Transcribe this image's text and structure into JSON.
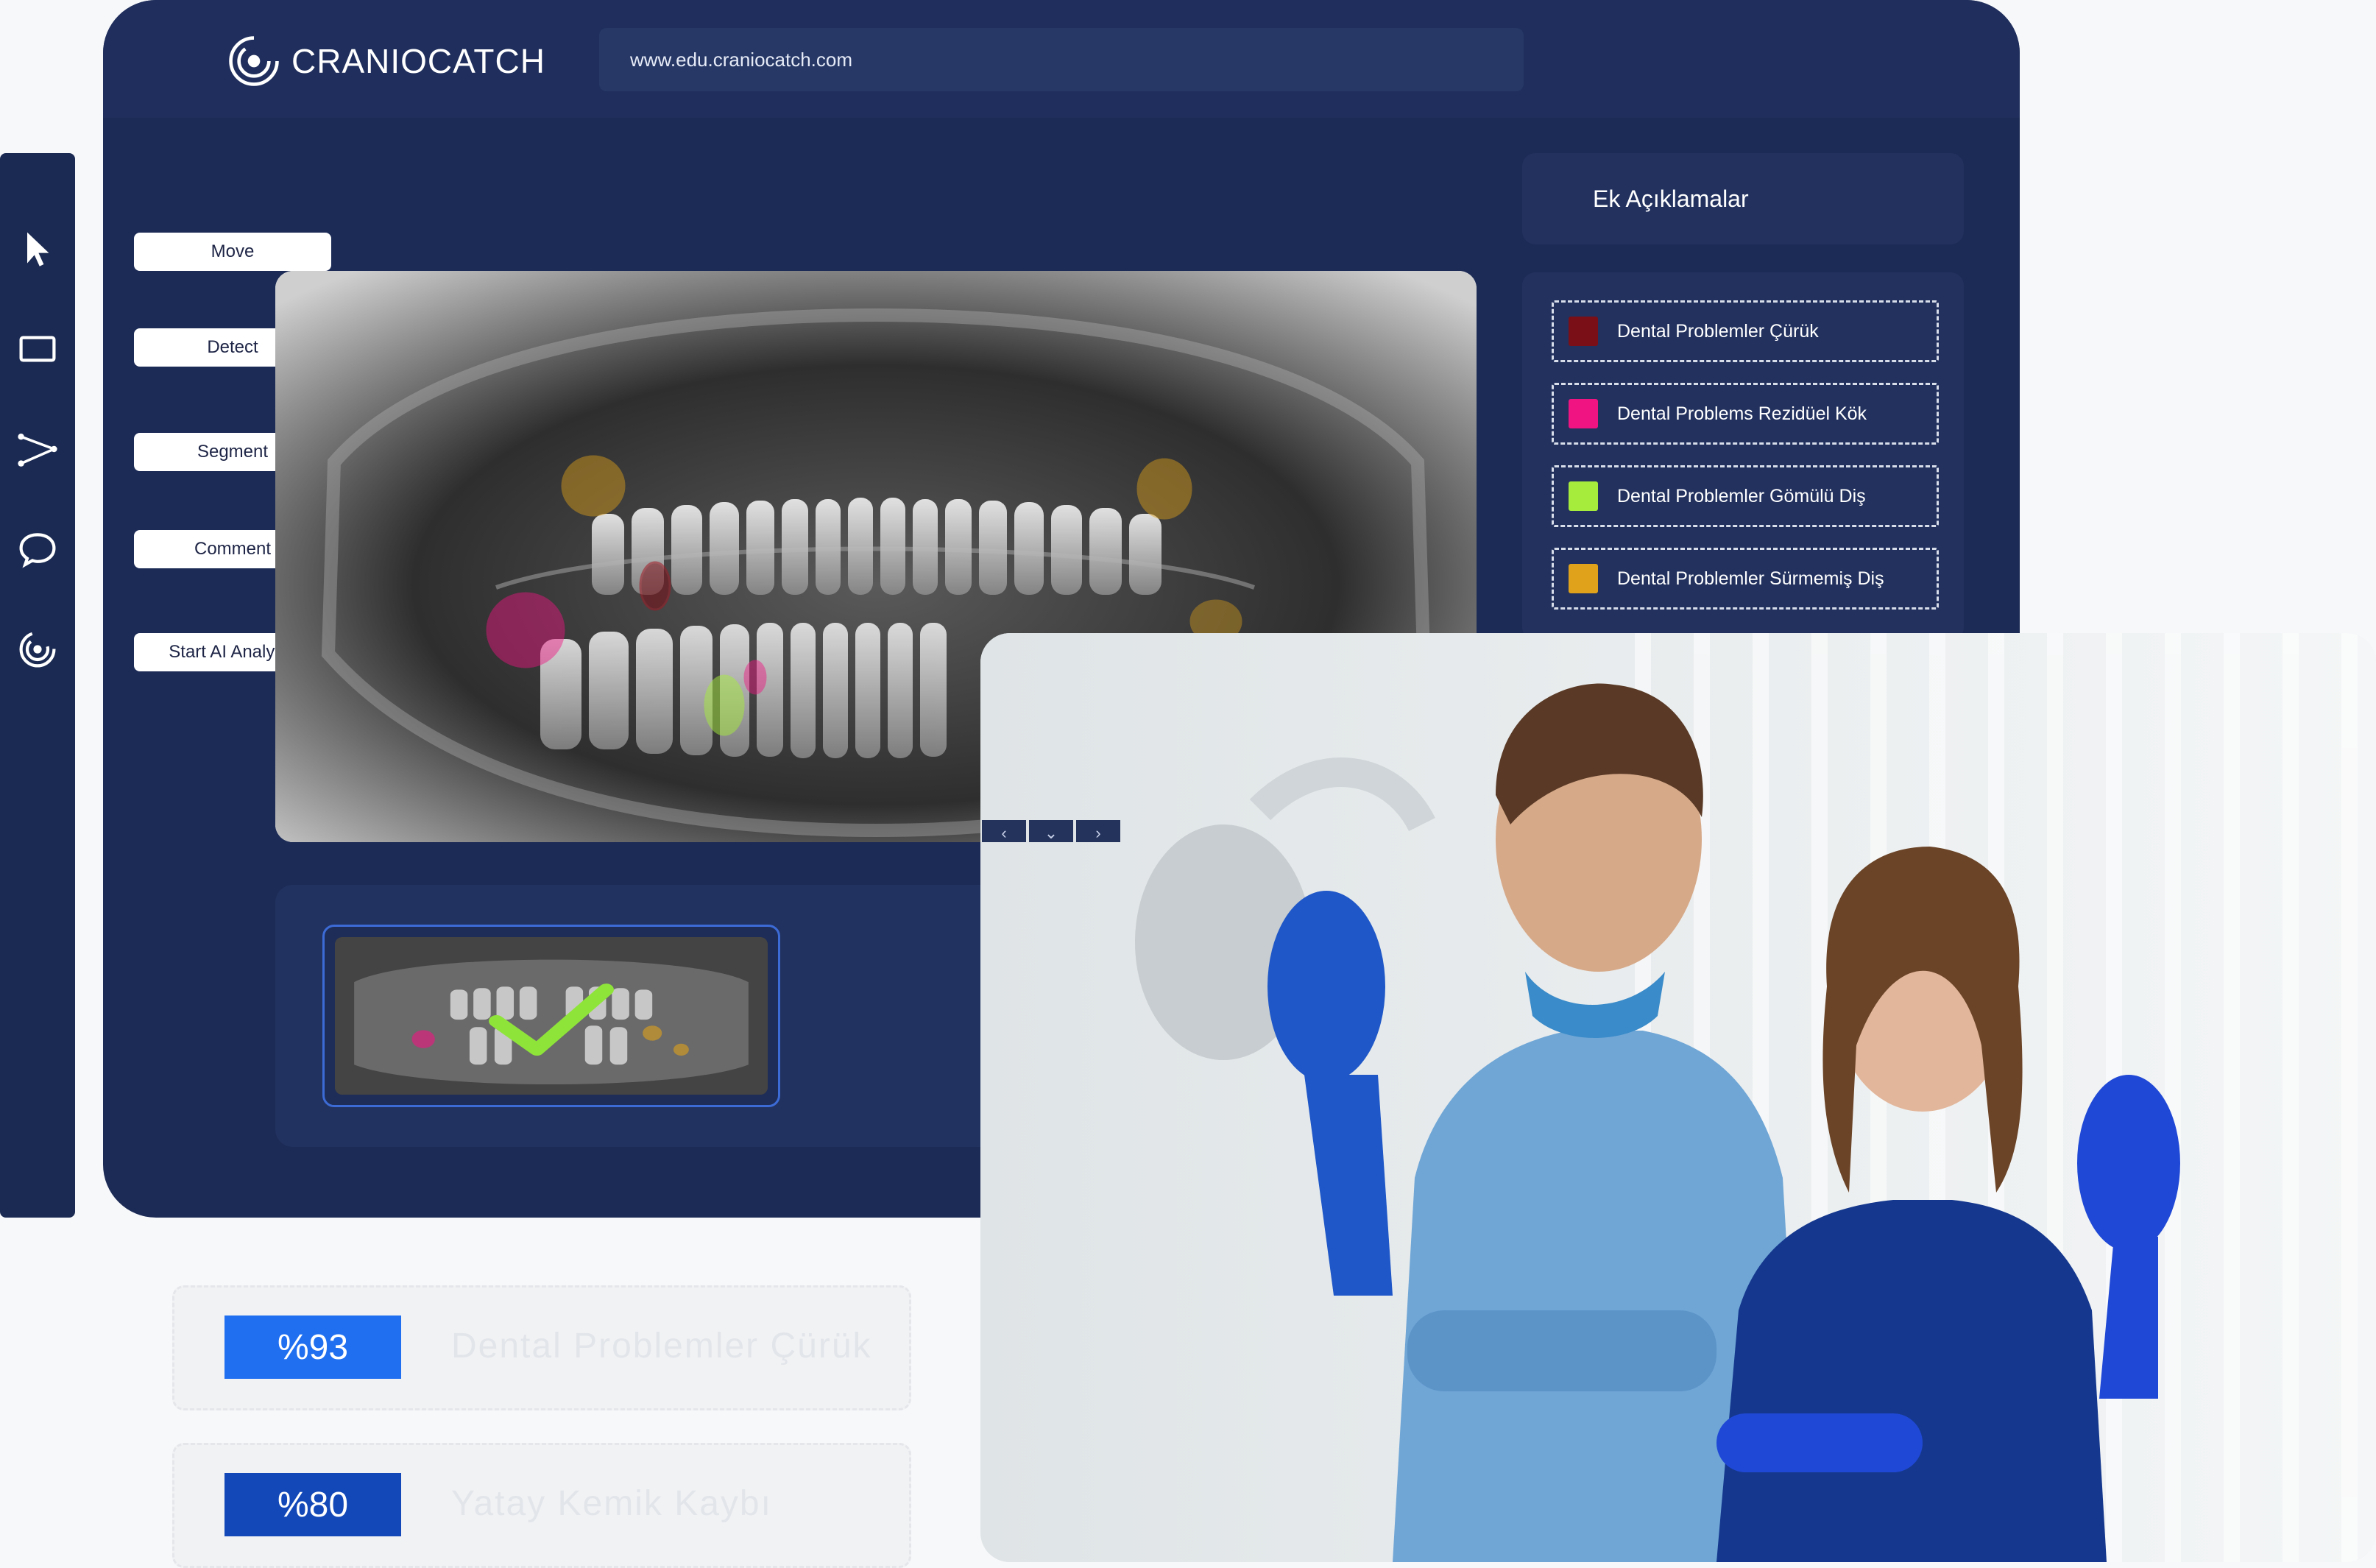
{
  "brand": {
    "name": "CRANIOCATCH"
  },
  "browser": {
    "url": "www.edu.craniocatch.com"
  },
  "toolbar_icons": [
    "cursor-icon",
    "rectangle-icon",
    "polyline-icon",
    "comment-bubble-icon",
    "ai-logo-icon"
  ],
  "actions": {
    "move": "Move",
    "detect": "Detect",
    "segment": "Segment",
    "comment": "Comment",
    "start_ai": "Start AI Analysis"
  },
  "image_nav": {
    "prev": "‹",
    "down": "⌄",
    "next": "›"
  },
  "legend": {
    "title": "Ek Açıklamalar",
    "items": [
      {
        "label": "Dental Problemler Çürük",
        "color": "#7a0f17"
      },
      {
        "label": "Dental Problems Rezidüel Kök",
        "color": "#f01482"
      },
      {
        "label": "Dental Problemler Gömülü Diş",
        "color": "#a6ec3d"
      },
      {
        "label": "Dental Problemler Sürmemiş Diş",
        "color": "#e0a21a"
      }
    ]
  },
  "stats": [
    {
      "percent": "%93",
      "label": "Dental Problemler Çürük",
      "color": "#1f6ff0"
    },
    {
      "percent": "%80",
      "label": "Yatay Kemik Kaybı",
      "color": "#1248b8"
    }
  ]
}
